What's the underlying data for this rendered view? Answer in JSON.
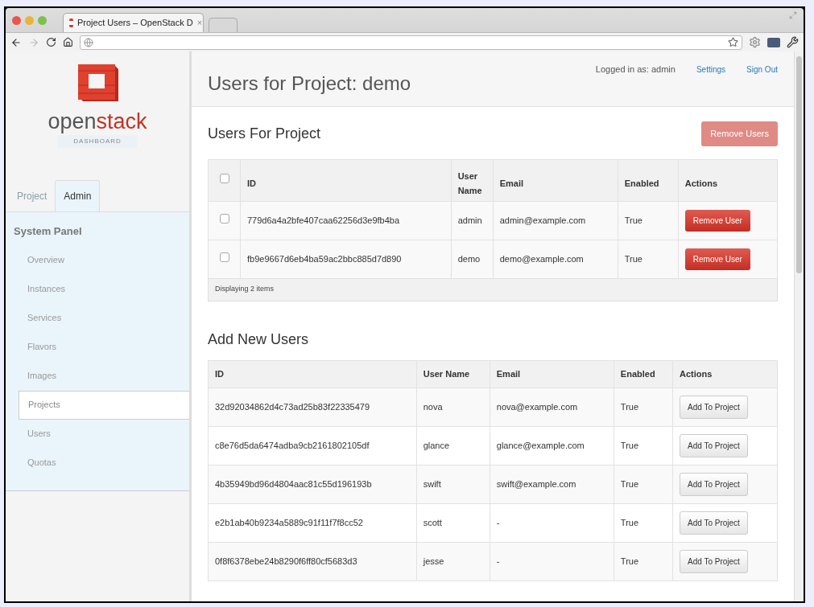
{
  "browser": {
    "tab_title": "Project Users – OpenStack D",
    "tab_close": "×"
  },
  "sidebar": {
    "logo_text_plain": "open",
    "logo_text_accent": "stack",
    "logo_subtitle": "DASHBOARD",
    "tabs": [
      {
        "label": "Project",
        "selected": false
      },
      {
        "label": "Admin",
        "selected": true
      }
    ],
    "panel_title": "System Panel",
    "items": [
      {
        "label": "Overview",
        "selected": false
      },
      {
        "label": "Instances",
        "selected": false
      },
      {
        "label": "Services",
        "selected": false
      },
      {
        "label": "Flavors",
        "selected": false
      },
      {
        "label": "Images",
        "selected": false
      },
      {
        "label": "Projects",
        "selected": true
      },
      {
        "label": "Users",
        "selected": false
      },
      {
        "label": "Quotas",
        "selected": false
      }
    ]
  },
  "header": {
    "title": "Users for Project: demo",
    "logged_in": "Logged in as: admin",
    "links": [
      "Settings",
      "Sign Out"
    ]
  },
  "project_users": {
    "title": "Users For Project",
    "bulk_button": {
      "label": "Remove Users",
      "disabled": true
    },
    "columns": [
      "ID",
      "User Name",
      "Email",
      "Enabled",
      "Actions"
    ],
    "select_all_checked": false,
    "rows": [
      {
        "checked": false,
        "id": "779d6a4a2bfe407caa62256d3e9fb4ba",
        "name": "admin",
        "email": "admin@example.com",
        "enabled": "True",
        "action": "Remove User"
      },
      {
        "checked": false,
        "id": "fb9e9667d6eb4ba59ac2bbc885d7d890",
        "name": "demo",
        "email": "demo@example.com",
        "enabled": "True",
        "action": "Remove User"
      }
    ],
    "footer": "Displaying 2 items"
  },
  "add_users": {
    "title": "Add New Users",
    "columns": [
      "ID",
      "User Name",
      "Email",
      "Enabled",
      "Actions"
    ],
    "rows": [
      {
        "id": "32d92034862d4c73ad25b83f22335479",
        "name": "nova",
        "email": "nova@example.com",
        "enabled": "True",
        "action": "Add To Project"
      },
      {
        "id": "c8e76d5da6474adba9cb2161802105df",
        "name": "glance",
        "email": "glance@example.com",
        "enabled": "True",
        "action": "Add To Project"
      },
      {
        "id": "4b35949bd96d4804aac81c55d196193b",
        "name": "swift",
        "email": "swift@example.com",
        "enabled": "True",
        "action": "Add To Project"
      },
      {
        "id": "e2b1ab40b9234a5889c91f11f7f8cc52",
        "name": "scott",
        "email": "-",
        "enabled": "True",
        "action": "Add To Project"
      },
      {
        "id": "0f8f6378ebe24b8290f6ff80cf5683d3",
        "name": "jesse",
        "email": "-",
        "enabled": "True",
        "action": "Add To Project"
      }
    ]
  }
}
